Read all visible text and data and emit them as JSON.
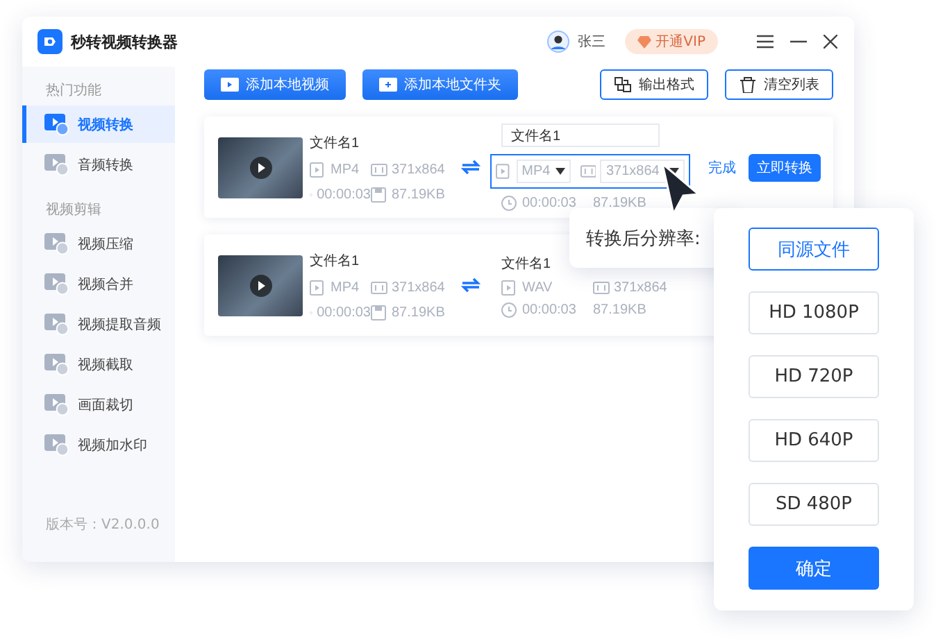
{
  "app": {
    "title": "秒转视频转换器"
  },
  "user": {
    "name": "张三"
  },
  "vip_button": "开通VIP",
  "sidebar": {
    "sections": [
      {
        "heading": "热门功能",
        "items": [
          {
            "label": "视频转换",
            "selected": true
          },
          {
            "label": "音频转换",
            "selected": false
          }
        ]
      },
      {
        "heading": "视频剪辑",
        "items": [
          {
            "label": "视频压缩",
            "selected": false
          },
          {
            "label": "视频合并",
            "selected": false
          },
          {
            "label": "视频提取音频",
            "selected": false
          },
          {
            "label": "视频截取",
            "selected": false
          },
          {
            "label": "画面裁切",
            "selected": false
          },
          {
            "label": "视频加水印",
            "selected": false
          }
        ]
      }
    ],
    "version": "版本号：V2.0.0.0"
  },
  "toolbar": {
    "buttons": [
      {
        "label": "添加本地视频",
        "kind": "primary"
      },
      {
        "label": "添加本地文件夹",
        "kind": "primary"
      },
      {
        "label": "输出格式",
        "kind": "outline"
      },
      {
        "label": "清空列表",
        "kind": "outline"
      }
    ]
  },
  "files": [
    {
      "name": "文件名1",
      "format": "MP4",
      "resolution": "371x864",
      "duration": "00:00:03",
      "size": "87.19KB",
      "output": {
        "name": "文件名1",
        "format": "MP4",
        "resolution": "371x864",
        "duration": "00:00:03",
        "size": "87.19KB",
        "editing": true
      },
      "done_link": "完成",
      "convert_button": "立即转换"
    },
    {
      "name": "文件名1",
      "format": "MP4",
      "resolution": "371x864",
      "duration": "00:00:03",
      "size": "87.19KB",
      "output": {
        "name": "文件名1",
        "format": "WAV",
        "resolution": "371x864",
        "duration": "00:00:03",
        "size": "87.19KB",
        "editing": false
      }
    }
  ],
  "resolution_popover": {
    "label": "转换后分辨率:",
    "options": [
      {
        "label": "同源文件",
        "selected": true
      },
      {
        "label": "HD 1080P",
        "selected": false
      },
      {
        "label": "HD 720P",
        "selected": false
      },
      {
        "label": "HD 640P",
        "selected": false
      },
      {
        "label": "SD 480P",
        "selected": false
      }
    ],
    "confirm": "确定"
  }
}
